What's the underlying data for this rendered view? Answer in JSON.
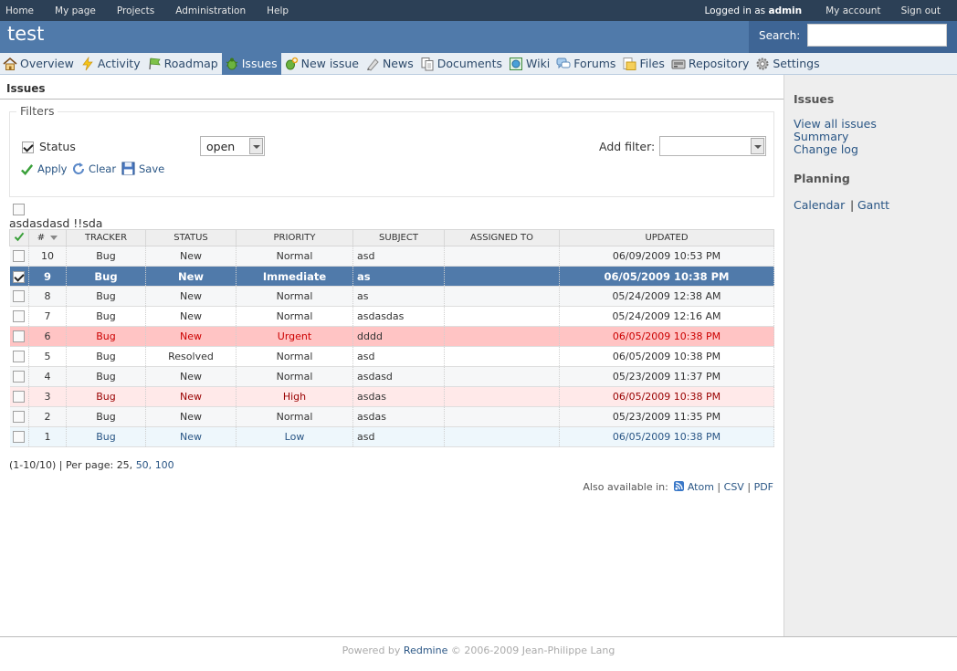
{
  "top_menu": {
    "items": [
      "Home",
      "My page",
      "Projects",
      "Administration",
      "Help"
    ],
    "logged_as_prefix": "Logged in as",
    "user": "admin",
    "my_account": "My account",
    "sign_out": "Sign out"
  },
  "header": {
    "title": "test",
    "search_label": "Search:",
    "search_value": ""
  },
  "main_menu": [
    {
      "label": "Overview",
      "icon": "home-icon"
    },
    {
      "label": "Activity",
      "icon": "lightning-icon"
    },
    {
      "label": "Roadmap",
      "icon": "roadmap-icon"
    },
    {
      "label": "Issues",
      "icon": "bug-icon"
    },
    {
      "label": "New issue",
      "icon": "new-issue-icon"
    },
    {
      "label": "News",
      "icon": "news-icon"
    },
    {
      "label": "Documents",
      "icon": "documents-icon"
    },
    {
      "label": "Wiki",
      "icon": "wiki-icon"
    },
    {
      "label": "Forums",
      "icon": "forums-icon"
    },
    {
      "label": "Files",
      "icon": "files-icon"
    },
    {
      "label": "Repository",
      "icon": "repository-icon"
    },
    {
      "label": "Settings",
      "icon": "settings-icon"
    }
  ],
  "content": {
    "title": "Issues",
    "filters": {
      "legend": "Filters",
      "status_label": "Status",
      "status_checked": true,
      "status_operator": "open",
      "add_filter_label": "Add filter:",
      "add_filter_value": "",
      "apply": "Apply",
      "clear": "Clear",
      "save": "Save"
    },
    "query_name": "asdasdasd !!sda",
    "table": {
      "headers": [
        "#",
        "TRACKER",
        "STATUS",
        "PRIORITY",
        "SUBJECT",
        "ASSIGNED TO",
        "UPDATED"
      ],
      "rows": [
        {
          "id": "10",
          "tracker": "Bug",
          "status": "New",
          "priority": "Normal",
          "subject": "asd",
          "assigned": "",
          "updated": "06/09/2009 10:53 PM",
          "style": "odd",
          "checked": false
        },
        {
          "id": "9",
          "tracker": "Bug",
          "status": "New",
          "priority": "Immediate",
          "subject": "as",
          "assigned": "",
          "updated": "06/05/2009 10:38 PM",
          "style": "selected",
          "checked": true
        },
        {
          "id": "8",
          "tracker": "Bug",
          "status": "New",
          "priority": "Normal",
          "subject": "as",
          "assigned": "",
          "updated": "05/24/2009 12:38 AM",
          "style": "odd",
          "checked": false
        },
        {
          "id": "7",
          "tracker": "Bug",
          "status": "New",
          "priority": "Normal",
          "subject": "asdasdas",
          "assigned": "",
          "updated": "05/24/2009 12:16 AM",
          "style": "even",
          "checked": false
        },
        {
          "id": "6",
          "tracker": "Bug",
          "status": "New",
          "priority": "Urgent",
          "subject": "dddd",
          "assigned": "",
          "updated": "06/05/2009 10:38 PM",
          "style": "urgent",
          "checked": false
        },
        {
          "id": "5",
          "tracker": "Bug",
          "status": "Resolved",
          "priority": "Normal",
          "subject": "asd",
          "assigned": "",
          "updated": "06/05/2009 10:38 PM",
          "style": "even",
          "checked": false
        },
        {
          "id": "4",
          "tracker": "Bug",
          "status": "New",
          "priority": "Normal",
          "subject": "asdasd",
          "assigned": "",
          "updated": "05/23/2009 11:37 PM",
          "style": "odd",
          "checked": false
        },
        {
          "id": "3",
          "tracker": "Bug",
          "status": "New",
          "priority": "High",
          "subject": "asdas",
          "assigned": "",
          "updated": "06/05/2009 10:38 PM",
          "style": "high",
          "checked": false
        },
        {
          "id": "2",
          "tracker": "Bug",
          "status": "New",
          "priority": "Normal",
          "subject": "asdas",
          "assigned": "",
          "updated": "05/23/2009 11:35 PM",
          "style": "odd",
          "checked": false
        },
        {
          "id": "1",
          "tracker": "Bug",
          "status": "New",
          "priority": "Low",
          "subject": "asd",
          "assigned": "",
          "updated": "06/05/2009 10:38 PM",
          "style": "low",
          "checked": false
        }
      ]
    },
    "pagination": {
      "range": "(1-10/10)",
      "per_page_label": "| Per page:",
      "current": "25,",
      "opt50": "50,",
      "opt100": "100"
    },
    "other_formats": {
      "label": "Also available in:",
      "atom": "Atom",
      "csv": "CSV",
      "pdf": "PDF",
      "sep": "|"
    }
  },
  "sidebar": {
    "issues_heading": "Issues",
    "view_all": "View all issues",
    "summary": "Summary",
    "change_log": "Change log",
    "planning_heading": "Planning",
    "calendar": "Calendar",
    "gantt": "Gantt",
    "sep": "|"
  },
  "footer": {
    "powered_by": "Powered by",
    "redmine": "Redmine",
    "copyright": "© 2006-2009 Jean-Philippe Lang"
  }
}
